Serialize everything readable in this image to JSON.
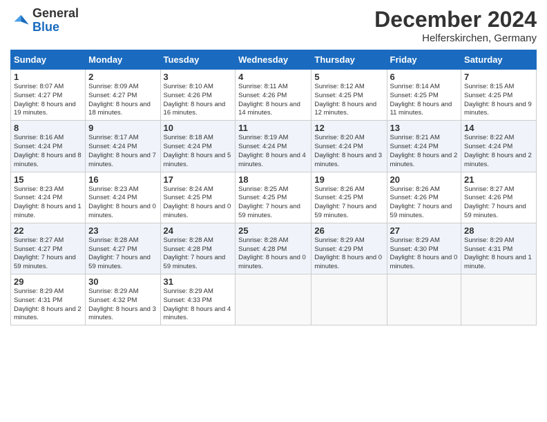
{
  "header": {
    "logo_line1": "General",
    "logo_line2": "Blue",
    "month_title": "December 2024",
    "location": "Helferskirchen, Germany"
  },
  "weekdays": [
    "Sunday",
    "Monday",
    "Tuesday",
    "Wednesday",
    "Thursday",
    "Friday",
    "Saturday"
  ],
  "weeks": [
    [
      {
        "day": "1",
        "sunrise": "8:07 AM",
        "sunset": "4:27 PM",
        "daylight": "8 hours and 19 minutes."
      },
      {
        "day": "2",
        "sunrise": "8:09 AM",
        "sunset": "4:27 PM",
        "daylight": "8 hours and 18 minutes."
      },
      {
        "day": "3",
        "sunrise": "8:10 AM",
        "sunset": "4:26 PM",
        "daylight": "8 hours and 16 minutes."
      },
      {
        "day": "4",
        "sunrise": "8:11 AM",
        "sunset": "4:26 PM",
        "daylight": "8 hours and 14 minutes."
      },
      {
        "day": "5",
        "sunrise": "8:12 AM",
        "sunset": "4:25 PM",
        "daylight": "8 hours and 12 minutes."
      },
      {
        "day": "6",
        "sunrise": "8:14 AM",
        "sunset": "4:25 PM",
        "daylight": "8 hours and 11 minutes."
      },
      {
        "day": "7",
        "sunrise": "8:15 AM",
        "sunset": "4:25 PM",
        "daylight": "8 hours and 9 minutes."
      }
    ],
    [
      {
        "day": "8",
        "sunrise": "8:16 AM",
        "sunset": "4:24 PM",
        "daylight": "8 hours and 8 minutes."
      },
      {
        "day": "9",
        "sunrise": "8:17 AM",
        "sunset": "4:24 PM",
        "daylight": "8 hours and 7 minutes."
      },
      {
        "day": "10",
        "sunrise": "8:18 AM",
        "sunset": "4:24 PM",
        "daylight": "8 hours and 5 minutes."
      },
      {
        "day": "11",
        "sunrise": "8:19 AM",
        "sunset": "4:24 PM",
        "daylight": "8 hours and 4 minutes."
      },
      {
        "day": "12",
        "sunrise": "8:20 AM",
        "sunset": "4:24 PM",
        "daylight": "8 hours and 3 minutes."
      },
      {
        "day": "13",
        "sunrise": "8:21 AM",
        "sunset": "4:24 PM",
        "daylight": "8 hours and 2 minutes."
      },
      {
        "day": "14",
        "sunrise": "8:22 AM",
        "sunset": "4:24 PM",
        "daylight": "8 hours and 2 minutes."
      }
    ],
    [
      {
        "day": "15",
        "sunrise": "8:23 AM",
        "sunset": "4:24 PM",
        "daylight": "8 hours and 1 minute."
      },
      {
        "day": "16",
        "sunrise": "8:23 AM",
        "sunset": "4:24 PM",
        "daylight": "8 hours and 0 minutes."
      },
      {
        "day": "17",
        "sunrise": "8:24 AM",
        "sunset": "4:25 PM",
        "daylight": "8 hours and 0 minutes."
      },
      {
        "day": "18",
        "sunrise": "8:25 AM",
        "sunset": "4:25 PM",
        "daylight": "7 hours and 59 minutes."
      },
      {
        "day": "19",
        "sunrise": "8:26 AM",
        "sunset": "4:25 PM",
        "daylight": "7 hours and 59 minutes."
      },
      {
        "day": "20",
        "sunrise": "8:26 AM",
        "sunset": "4:26 PM",
        "daylight": "7 hours and 59 minutes."
      },
      {
        "day": "21",
        "sunrise": "8:27 AM",
        "sunset": "4:26 PM",
        "daylight": "7 hours and 59 minutes."
      }
    ],
    [
      {
        "day": "22",
        "sunrise": "8:27 AM",
        "sunset": "4:27 PM",
        "daylight": "7 hours and 59 minutes."
      },
      {
        "day": "23",
        "sunrise": "8:28 AM",
        "sunset": "4:27 PM",
        "daylight": "7 hours and 59 minutes."
      },
      {
        "day": "24",
        "sunrise": "8:28 AM",
        "sunset": "4:28 PM",
        "daylight": "7 hours and 59 minutes."
      },
      {
        "day": "25",
        "sunrise": "8:28 AM",
        "sunset": "4:28 PM",
        "daylight": "8 hours and 0 minutes."
      },
      {
        "day": "26",
        "sunrise": "8:29 AM",
        "sunset": "4:29 PM",
        "daylight": "8 hours and 0 minutes."
      },
      {
        "day": "27",
        "sunrise": "8:29 AM",
        "sunset": "4:30 PM",
        "daylight": "8 hours and 0 minutes."
      },
      {
        "day": "28",
        "sunrise": "8:29 AM",
        "sunset": "4:31 PM",
        "daylight": "8 hours and 1 minute."
      }
    ],
    [
      {
        "day": "29",
        "sunrise": "8:29 AM",
        "sunset": "4:31 PM",
        "daylight": "8 hours and 2 minutes."
      },
      {
        "day": "30",
        "sunrise": "8:29 AM",
        "sunset": "4:32 PM",
        "daylight": "8 hours and 3 minutes."
      },
      {
        "day": "31",
        "sunrise": "8:29 AM",
        "sunset": "4:33 PM",
        "daylight": "8 hours and 4 minutes."
      },
      null,
      null,
      null,
      null
    ]
  ]
}
